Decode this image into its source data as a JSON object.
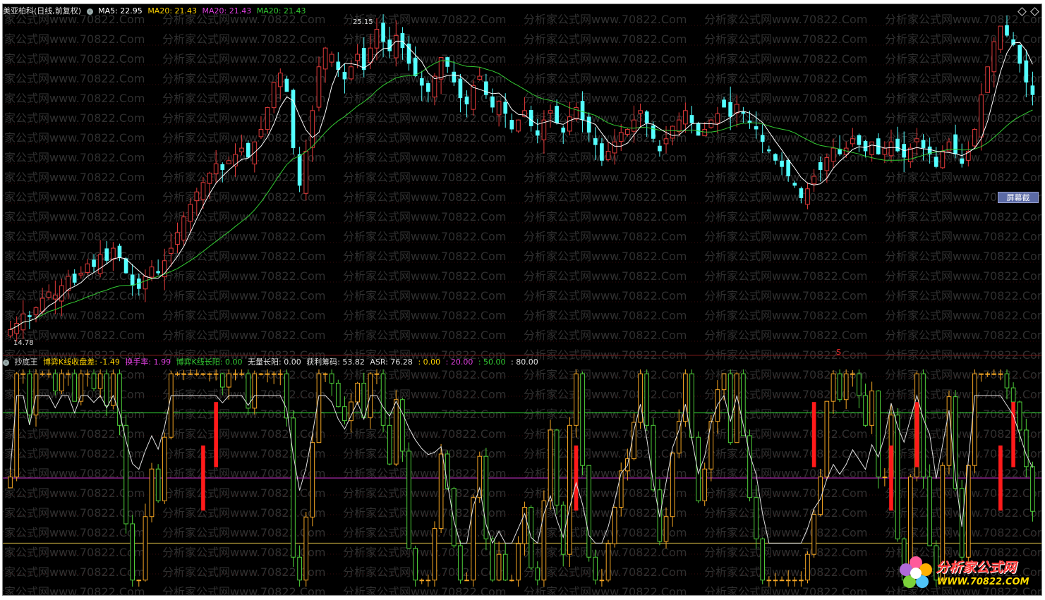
{
  "main_header": {
    "stock_title": "美亚柏科(日线,前复权)",
    "ma5_label": "MA5: 22.95",
    "ma20_label_a": "MA20: 21.43",
    "ma20_label_b": "MA20: 21.43",
    "ma20_label_c": "MA20: 21.43"
  },
  "indicator_header": {
    "name": "抄底王",
    "v1": "博弈K线收盘差: -1.49",
    "v2": "换手率: 1.99",
    "v3": "博弈K线长阳: 0.00",
    "v4": "无量长阳: 0.00",
    "v5": "获利筹码: 53.82",
    "v6": "ASR: 76.28",
    "v7": ": 0.00",
    "v8": ": 20.00",
    "v9": ": 50.00",
    "v10": ": 80.00"
  },
  "price_labels": {
    "high": "25.15",
    "low": "14.78"
  },
  "screenshot_tag": "屏幕截",
  "signal_marker": "S",
  "watermark_text": "分析家公式网www.70822.Com",
  "logo": {
    "name": "分析家公式网",
    "url": "WWW.70822.COM"
  },
  "colors": {
    "bg": "#000000",
    "up_candle": "#e23a3a",
    "down_candle": "#54ffff",
    "ma5": "#ffffff",
    "ma20": "#33cc33",
    "ind_up": "#f5a623",
    "ind_down": "#4fd13a",
    "line_80": "#33cc33",
    "line_50": "#cc33cc",
    "line_20": "#c9b040"
  },
  "chart_data": {
    "type": "candlestick",
    "title": "美亚柏科(日线,前复权)",
    "price_range": [
      14.78,
      25.15
    ],
    "series": [
      {
        "name": "MA5",
        "last": 22.95
      },
      {
        "name": "MA20",
        "last": 21.43
      }
    ],
    "indicator": {
      "name": "抄底王",
      "levels": [
        0,
        20,
        50,
        80
      ],
      "values": {
        "博弈K线收盘差": -1.49,
        "换手率": 1.99,
        "博弈K线长阳": 0.0,
        "无量长阳": 0.0,
        "获利筹码": 53.82,
        "ASR": 76.28
      }
    },
    "close": [
      15.2,
      15.4,
      15.7,
      15.6,
      15.9,
      16.2,
      16.4,
      16.3,
      16.6,
      16.9,
      16.7,
      17.0,
      17.3,
      17.2,
      17.6,
      17.4,
      17.8,
      17.5,
      17.0,
      16.6,
      16.5,
      16.9,
      17.2,
      17.0,
      17.4,
      17.8,
      18.3,
      18.8,
      19.2,
      19.6,
      19.9,
      20.2,
      20.5,
      20.3,
      20.6,
      20.8,
      21.0,
      20.7,
      21.2,
      21.6,
      22.3,
      23.1,
      23.4,
      22.8,
      21.0,
      19.8,
      20.9,
      22.2,
      23.6,
      24.2,
      24.0,
      23.5,
      23.2,
      23.6,
      24.0,
      23.5,
      24.2,
      24.8,
      24.4,
      24.1,
      24.6,
      24.2,
      23.7,
      23.3,
      23.0,
      22.8,
      23.3,
      23.9,
      23.6,
      23.1,
      22.6,
      22.4,
      23.0,
      23.3,
      22.7,
      22.3,
      22.5,
      22.1,
      21.6,
      21.9,
      22.2,
      21.7,
      21.4,
      21.9,
      22.2,
      21.8,
      21.5,
      22.0,
      22.3,
      21.9,
      21.5,
      21.1,
      20.6,
      20.9,
      21.2,
      21.5,
      21.6,
      21.9,
      22.2,
      21.8,
      21.3,
      20.9,
      21.3,
      21.7,
      21.9,
      22.2,
      21.8,
      21.4,
      21.6,
      21.9,
      22.1,
      22.3,
      22.0,
      22.4,
      22.1,
      21.8,
      21.6,
      21.2,
      20.9,
      20.6,
      20.4,
      20.1,
      19.8,
      19.4,
      19.7,
      20.1,
      20.3,
      20.7,
      21.0,
      20.8,
      21.0,
      21.3,
      21.1,
      20.9,
      21.2,
      20.8,
      21.0,
      21.2,
      20.9,
      20.7,
      21.0,
      21.3,
      21.0,
      20.8,
      20.4,
      20.9,
      21.2,
      20.8,
      20.5,
      20.9,
      21.6,
      22.7,
      23.6,
      24.4,
      24.9,
      24.6,
      24.3,
      23.7,
      23.1,
      22.7
    ]
  }
}
